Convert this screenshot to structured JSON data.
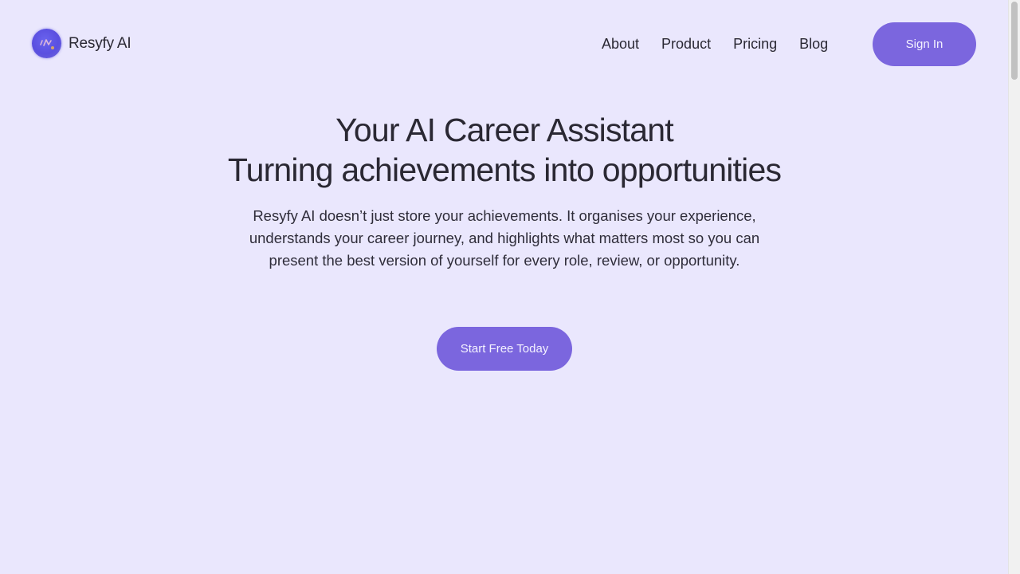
{
  "header": {
    "logo_text": "Resyfy AI",
    "nav": [
      {
        "label": "About"
      },
      {
        "label": "Product"
      },
      {
        "label": "Pricing"
      },
      {
        "label": "Blog"
      }
    ],
    "sign_in_label": "Sign In"
  },
  "hero": {
    "title_line1": "Your AI Career Assistant",
    "title_line2": "Turning achievements into opportunities",
    "description": "Resyfy AI doesn’t just store your achievements. It organises your experience, understands your career journey, and highlights what matters most so you can present the best version of yourself for every role, review, or opportunity.",
    "cta_label": "Start Free Today"
  },
  "colors": {
    "background": "#EAE7FD",
    "accent": "#7B66DE",
    "text": "#2A2833"
  },
  "icons": {
    "logo": "resyfy-logo-icon"
  }
}
